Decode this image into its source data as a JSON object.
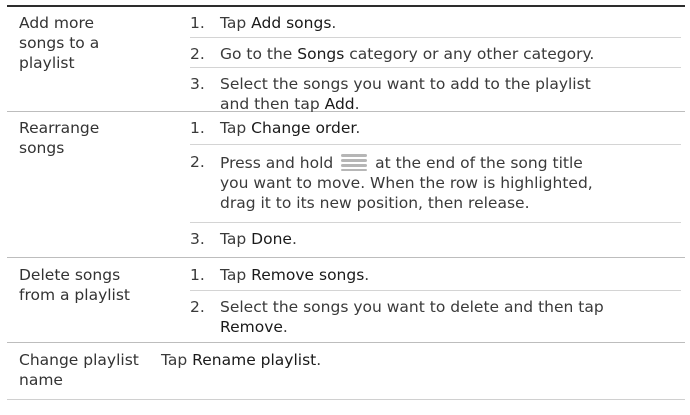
{
  "rows": [
    {
      "task": [
        "Add more",
        "songs to a",
        "playlist"
      ],
      "steps": [
        {
          "num": "1.",
          "parts": [
            "Tap ",
            {
              "ui": "Add songs"
            },
            "."
          ]
        },
        {
          "num": "2.",
          "parts": [
            "Go to the ",
            {
              "ui": "Songs"
            },
            " category or any other category."
          ]
        },
        {
          "num": "3.",
          "lines": [
            "Select the songs you want to add to the playlist",
            [
              "and then tap ",
              {
                "ui": "Add"
              },
              "."
            ]
          ]
        }
      ]
    },
    {
      "task": [
        "Rearrange",
        "songs"
      ],
      "steps": [
        {
          "num": "1.",
          "parts": [
            "Tap ",
            {
              "ui": "Change order"
            },
            "."
          ]
        },
        {
          "num": "2.",
          "lines": [
            [
              "Press and hold ",
              {
                "icon": "drag-handle-icon"
              },
              " at the end of the song title"
            ],
            "you want to move. When the row is highlighted,",
            "drag it to its new position, then release."
          ]
        },
        {
          "num": "3.",
          "parts": [
            "Tap ",
            {
              "ui": "Done"
            },
            "."
          ]
        }
      ]
    },
    {
      "task": [
        "Delete songs",
        "from a playlist"
      ],
      "steps": [
        {
          "num": "1.",
          "parts": [
            "Tap ",
            {
              "ui": "Remove songs"
            },
            "."
          ]
        },
        {
          "num": "2.",
          "lines": [
            "Select the songs you want to delete and then tap",
            [
              {
                "ui": "Remove"
              },
              "."
            ]
          ]
        }
      ]
    },
    {
      "task": [
        "Change playlist",
        "name"
      ],
      "plain": [
        "Tap ",
        {
          "ui": "Rename playlist"
        },
        "."
      ]
    }
  ]
}
